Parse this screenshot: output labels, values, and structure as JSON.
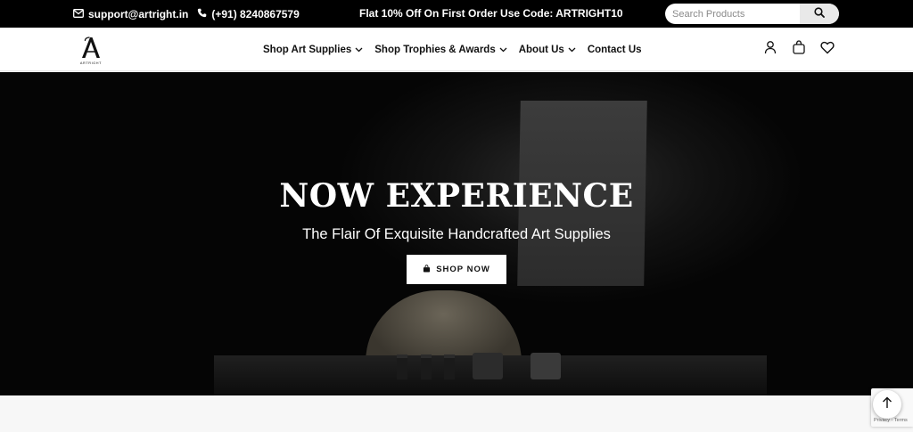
{
  "topbar": {
    "email": "support@artright.in",
    "phone": "(+91) 8240867579",
    "promo": "Flat 10% Off On First Order Use Code: ARTRIGHT10",
    "search_placeholder": "Search Products"
  },
  "logo": {
    "mark": "A",
    "text": "ARTRIGHT"
  },
  "nav": {
    "items": [
      {
        "label": "Shop Art Supplies",
        "dropdown": true
      },
      {
        "label": "Shop Trophies & Awards",
        "dropdown": true
      },
      {
        "label": "About Us",
        "dropdown": true
      },
      {
        "label": "Contact Us",
        "dropdown": false
      }
    ],
    "icons": [
      "user-icon",
      "bag-icon",
      "heart-icon"
    ]
  },
  "hero": {
    "title": "NOW EXPERIENCE",
    "subtitle": "The Flair Of Exquisite Handcrafted Art Supplies",
    "button_label": "SHOP NOW"
  },
  "recaptcha": {
    "text": "Privacy - Terms"
  },
  "colors": {
    "topbar_bg": "#000000",
    "nav_bg": "#ffffff",
    "hero_bg": "#0a0a0a",
    "button_bg": "#ffffff"
  }
}
